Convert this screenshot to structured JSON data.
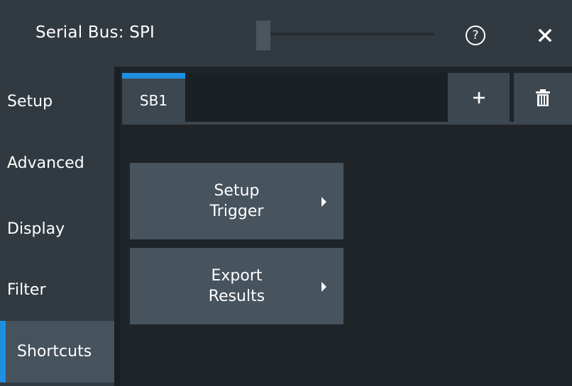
{
  "window": {
    "title": "Serial Bus: SPI",
    "help_icon": "help-circle-icon",
    "help_glyph": "?",
    "close_icon": "close-icon"
  },
  "sidebar": {
    "items": [
      {
        "label": "Setup",
        "active": false
      },
      {
        "label": "Advanced",
        "active": false
      },
      {
        "label": "Display",
        "active": false
      },
      {
        "label": "Filter",
        "active": false
      },
      {
        "label": "Shortcuts",
        "active": true
      }
    ]
  },
  "tabs": {
    "items": [
      {
        "label": "SB1",
        "selected": true
      }
    ],
    "add_icon": "plus-icon",
    "delete_icon": "trash-icon"
  },
  "main": {
    "buttons": [
      {
        "line1": "Setup",
        "line2": "Trigger",
        "icon": "chevron-right-icon"
      },
      {
        "line1": "Export",
        "line2": "Results",
        "icon": "chevron-right-icon"
      }
    ]
  },
  "colors": {
    "accent": "#1f8fe0",
    "background": "#1f2428",
    "panel": "#323a41",
    "button": "#47535d"
  }
}
